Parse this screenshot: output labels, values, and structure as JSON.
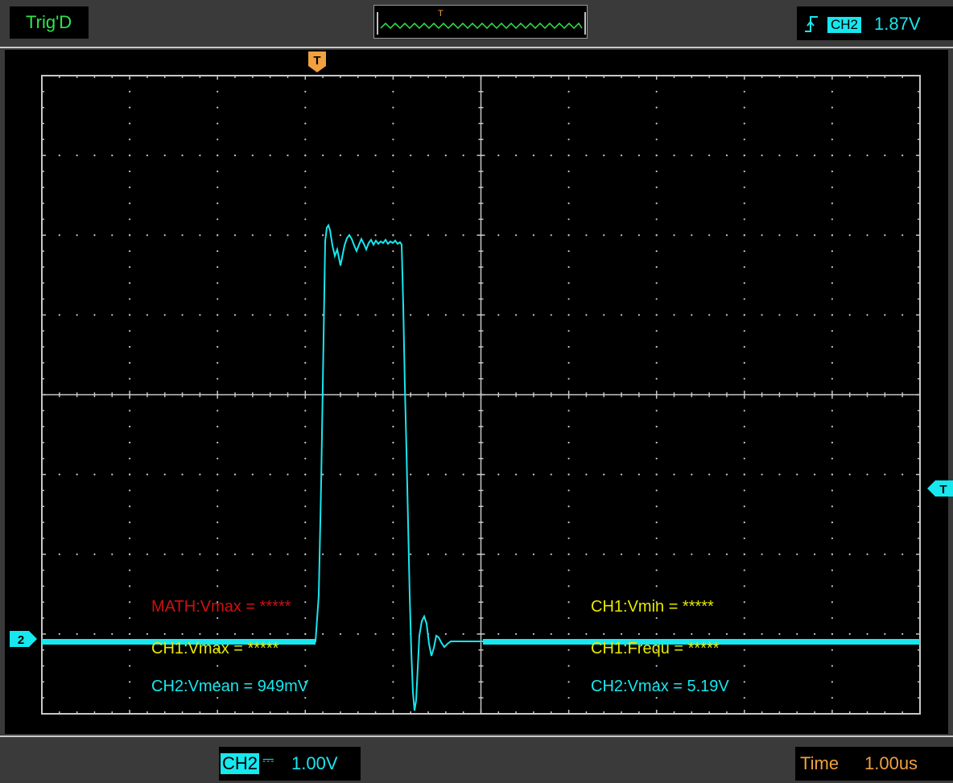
{
  "status": {
    "trigger_state": "Trig'D"
  },
  "overview": {
    "trigger_marker": "T"
  },
  "trigger": {
    "source": "CH2",
    "level": "1.87V",
    "edge": "rising-edge-icon"
  },
  "markers": {
    "trigger_time": "T",
    "trigger_level": "T",
    "channel2_ground": "2"
  },
  "measurements": {
    "math_vmax": "MATH:Vmax = *****",
    "ch1_vmin": "CH1:Vmin = *****",
    "ch1_vmax": "CH1:Vmax = *****",
    "ch1_frequ": "CH1:Frequ = *****",
    "ch2_vmean": "CH2:Vmean = 949mV",
    "ch2_vmax": "CH2:Vmax = 5.19V"
  },
  "channel": {
    "name": "CH2",
    "coupling": "⎓",
    "scale": "1.00V"
  },
  "timebase": {
    "label": "Time",
    "scale": "1.00us"
  },
  "colors": {
    "ch2": "#17e7ef",
    "ch1_text": "#e8e800",
    "math_text": "#d01010",
    "trigger_marker": "#f0a040",
    "trig_status": "#2ee64a",
    "grid": "#c8c8c8"
  }
}
